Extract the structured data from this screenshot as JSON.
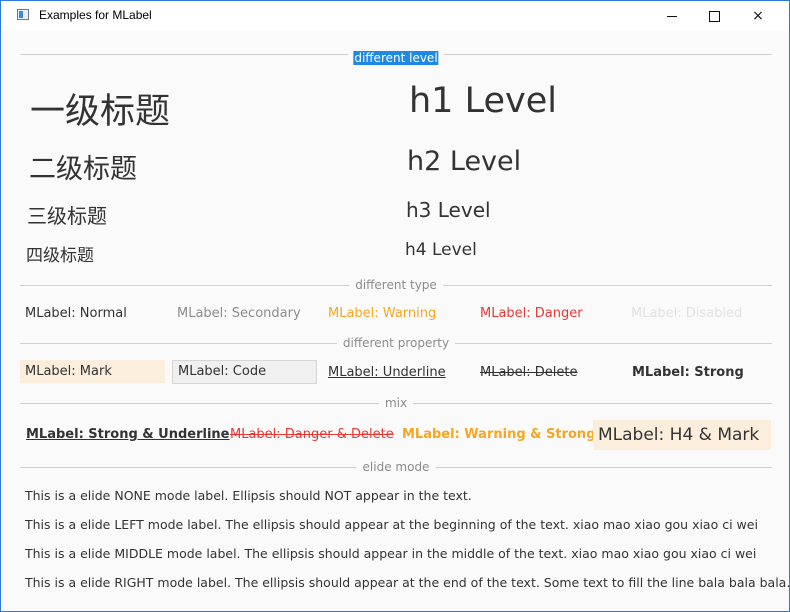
{
  "window": {
    "title": "Examples for MLabel",
    "controls": {
      "minimize": "minimize",
      "maximize": "maximize",
      "close": "×"
    }
  },
  "sections": {
    "level": "different level",
    "type": "different type",
    "property": "different property",
    "mix": "mix",
    "elide": "elide mode"
  },
  "levels": {
    "cn_h1": "一级标题",
    "cn_h2": "二级标题",
    "cn_h3": "三级标题",
    "cn_h4": "四级标题",
    "en_h1": "h1 Level",
    "en_h2": "h2 Level",
    "en_h3": "h3 Level",
    "en_h4": "h4 Level"
  },
  "types": {
    "normal": "MLabel: Normal",
    "secondary": "MLabel: Secondary",
    "warning": "MLabel: Warning",
    "danger": "MLabel: Danger",
    "disabled": "MLabel: Disabled"
  },
  "properties": {
    "mark": "MLabel: Mark",
    "code": "MLabel: Code",
    "underline": "MLabel: Underline",
    "delete": "MLabel: Delete",
    "strong": "MLabel: Strong"
  },
  "mix": {
    "strong_underline": "MLabel: Strong & Underline",
    "danger_delete": "MLabel: Danger & Delete",
    "warning_strong": "MLabel: Warning & Strong",
    "h4_mark": "MLabel: H4 & Mark"
  },
  "elide": {
    "none": "This is a elide NONE mode label. Ellipsis should NOT appear in the text.",
    "left": "This is a elide LEFT mode label. The ellipsis should appear at the beginning of the text. xiao mao xiao gou xiao ci wei",
    "middle": "This is a elide MIDDLE mode label. The ellipsis should appear in the middle of the text. xiao mao xiao gou xiao ci wei",
    "right": "This is a elide RIGHT mode label. The ellipsis should appear at the end of the text. Some text to fill the line bala bala bala."
  },
  "colors": {
    "accent": "#1e88e5",
    "secondary": "#8c8c8c",
    "warning": "#f5a623",
    "danger": "#e53935",
    "disabled": "#e2e2e2",
    "mark_bg": "#fbeedd",
    "code_bg": "#f0f0f0"
  }
}
